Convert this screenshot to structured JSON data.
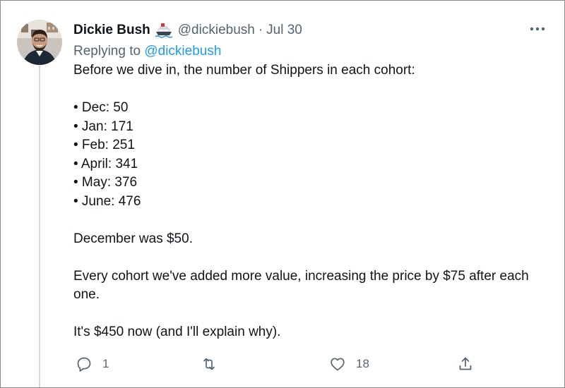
{
  "tweet": {
    "author_name": "Dickie Bush",
    "author_emoji": "ship-icon",
    "handle": "@dickiebush",
    "separator": "·",
    "date": "Jul 30",
    "replying_prefix": "Replying to",
    "replying_to": "@dickiebush",
    "intro": "Before we dive in, the number of Shippers in each cohort:",
    "bullets": [
      "• Dec: 50",
      "• Jan: 171",
      "• Feb: 251",
      "• April: 341",
      "• May: 376",
      "• June: 476"
    ],
    "para1": "December was $50.",
    "para2_line1": "Every cohort we've added more value, increasing the price by $75 after each",
    "para2_line2": "one.",
    "para3": "It's $450 now (and I'll explain why)."
  },
  "actions": {
    "reply_count": "1",
    "retweet_count": "",
    "like_count": "18"
  },
  "colors": {
    "text": "#0f1419",
    "secondary": "#536471",
    "link": "#1d9bf0",
    "thread_line": "#cfd9de"
  }
}
